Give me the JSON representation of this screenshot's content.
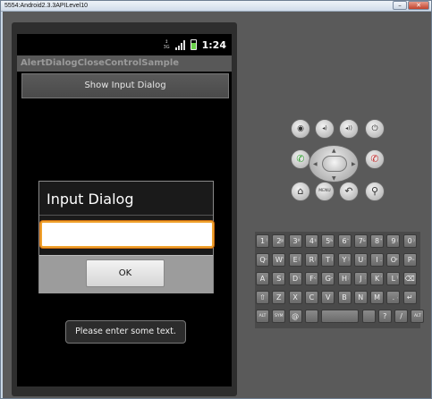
{
  "window": {
    "title": "5554:Android2.3.3APILevel10"
  },
  "status": {
    "clock": "1:24",
    "network": "3G"
  },
  "app": {
    "title": "AlertDialogCloseControlSample",
    "show_button": "Show Input Dialog"
  },
  "dialog": {
    "title": "Input Dialog",
    "input_value": "",
    "ok": "OK"
  },
  "toast": "Please enter some text.",
  "keys": {
    "row1": [
      "1",
      "2",
      "3",
      "4",
      "5",
      "6",
      "7",
      "8",
      "9",
      "0"
    ],
    "row1_alt": [
      "!",
      "@",
      "#",
      "$",
      "%",
      "^",
      "&",
      "*",
      "(",
      ")"
    ],
    "row2": [
      "Q",
      "W",
      "E",
      "R",
      "T",
      "Y",
      "U",
      "I",
      "O",
      "P"
    ],
    "row2_alt": [
      "~",
      "\"",
      "{",
      "}",
      "[",
      "]",
      "-",
      "_",
      "+",
      "="
    ],
    "row3": [
      "A",
      "S",
      "D",
      "F",
      "G",
      "H",
      "J",
      "K",
      "L",
      "⌫"
    ],
    "row3_alt": [
      "`",
      "|",
      "\\",
      "<",
      ">",
      ";",
      ":",
      "'",
      "?",
      ""
    ],
    "row4": [
      "⇧",
      "Z",
      "X",
      "C",
      "V",
      "B",
      "N",
      "M",
      ".",
      "↵"
    ],
    "row4_alt": [
      "",
      "",
      "",
      "",
      "",
      "",
      "",
      "",
      ",",
      ""
    ],
    "row5": [
      "ALT",
      "SYM",
      "@",
      "",
      "",
      "",
      "?",
      "/",
      "ALT"
    ],
    "row5_alt": [
      "",
      "",
      "",
      "",
      "",
      "",
      "",
      "",
      ""
    ]
  },
  "controls": {
    "camera": "◉",
    "vol_down": "◂)",
    "vol_up": "◂))",
    "power": "⏻",
    "call": "✆",
    "end_call": "✆",
    "home": "⌂",
    "menu": "MENU",
    "back": "↶",
    "search": "⚲"
  }
}
